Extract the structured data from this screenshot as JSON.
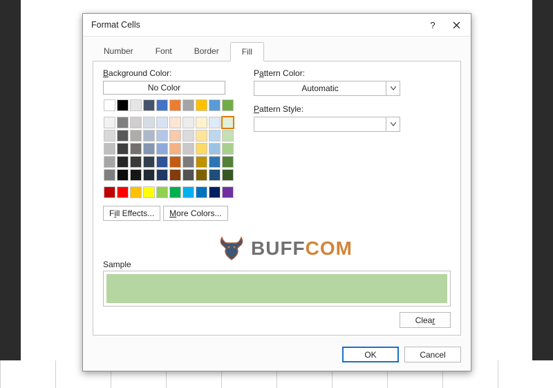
{
  "dialog": {
    "title": "Format Cells",
    "tabs": [
      "Number",
      "Font",
      "Border",
      "Fill"
    ],
    "active_tab": "Fill",
    "bg_color_label": "Background Color:",
    "no_color_label": "No Color",
    "fill_effects_label": "Fill Effects...",
    "more_colors_label": "More Colors...",
    "pattern_color_label": "Pattern Color:",
    "pattern_color_value": "Automatic",
    "pattern_style_label": "Pattern Style:",
    "pattern_style_value": "",
    "sample_label": "Sample",
    "sample_fill": "#b5d6a0",
    "clear_label": "Clear",
    "ok_label": "OK",
    "cancel_label": "Cancel"
  },
  "palette": {
    "row1": [
      "#ffffff",
      "#000000",
      "#e7e6e6",
      "#44546a",
      "#4472c4",
      "#ed7d31",
      "#a5a5a5",
      "#ffc000",
      "#5b9bd5",
      "#70ad47"
    ],
    "theme": [
      [
        "#f2f2f2",
        "#7f7f7f",
        "#d0cece",
        "#d6dce4",
        "#d9e2f3",
        "#fbe5d5",
        "#ededed",
        "#fff2cc",
        "#deebf6",
        "#e2efd9"
      ],
      [
        "#d8d8d8",
        "#595959",
        "#aeabab",
        "#adb9ca",
        "#b4c6e7",
        "#f7caac",
        "#dbdbdb",
        "#ffe599",
        "#bdd7ee",
        "#c5e0b3"
      ],
      [
        "#bfbfbf",
        "#3f3f3f",
        "#757070",
        "#8496b0",
        "#8eaadb",
        "#f4b183",
        "#c9c9c9",
        "#ffd965",
        "#9cc3e5",
        "#a8d08d"
      ],
      [
        "#a5a5a5",
        "#262626",
        "#3a3838",
        "#323f4f",
        "#2f5496",
        "#c55a11",
        "#7b7b7b",
        "#bf9000",
        "#2e75b5",
        "#538135"
      ],
      [
        "#7f7f7f",
        "#0c0c0c",
        "#171616",
        "#222a35",
        "#1f3864",
        "#833c0b",
        "#525252",
        "#7f6000",
        "#1e4e79",
        "#375623"
      ]
    ],
    "standard": [
      "#c00000",
      "#ff0000",
      "#ffc000",
      "#ffff00",
      "#92d050",
      "#00b050",
      "#00b0f0",
      "#0070c0",
      "#002060",
      "#7030a0"
    ],
    "selected": "#e2efd9"
  },
  "watermark": {
    "text1": "BUFF",
    "text2": "COM"
  }
}
